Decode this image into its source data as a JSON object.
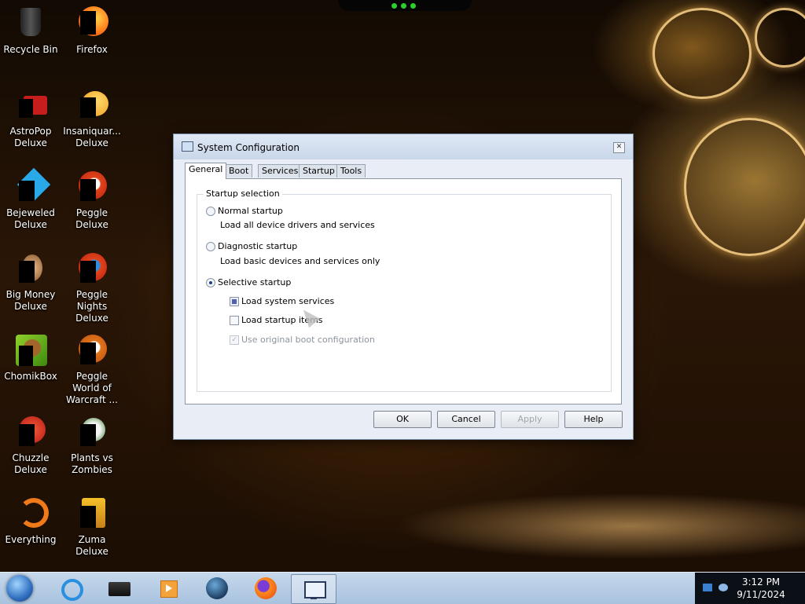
{
  "desktop": {
    "icons": [
      {
        "label": "Recycle Bin",
        "icon": "recycle-bin-icon"
      },
      {
        "label": "Firefox",
        "icon": "firefox-icon"
      },
      {
        "label": "AstroPop Deluxe",
        "icon": "astropop-icon"
      },
      {
        "label": "Insaniquar... Deluxe",
        "icon": "insaniquarium-icon"
      },
      {
        "label": "Bejeweled Deluxe",
        "icon": "bejeweled-icon"
      },
      {
        "label": "Peggle Deluxe",
        "icon": "peggle-icon"
      },
      {
        "label": "Big Money Deluxe",
        "icon": "big-money-icon"
      },
      {
        "label": "Peggle Nights Deluxe",
        "icon": "peggle-nights-icon"
      },
      {
        "label": "ChomikBox",
        "icon": "chomikbox-icon"
      },
      {
        "label": "Peggle World of Warcraft ...",
        "icon": "peggle-wow-icon"
      },
      {
        "label": "Chuzzle Deluxe",
        "icon": "chuzzle-icon"
      },
      {
        "label": "Plants vs Zombies",
        "icon": "plants-vs-zombies-icon"
      },
      {
        "label": "Everything",
        "icon": "everything-search-icon"
      },
      {
        "label": "Zuma Deluxe",
        "icon": "zuma-icon"
      }
    ]
  },
  "dialog": {
    "title": "System Configuration",
    "close_glyph": "✕",
    "tabs": [
      "General",
      "Boot",
      "Services",
      "Startup",
      "Tools"
    ],
    "active_tab": "General",
    "group_label": "Startup selection",
    "options": {
      "normal": {
        "label": "Normal startup",
        "desc": "Load all device drivers and services"
      },
      "diagnostic": {
        "label": "Diagnostic startup",
        "desc": "Load basic devices and services only"
      },
      "selective": {
        "label": "Selective startup"
      }
    },
    "selected_option": "selective",
    "checks": {
      "system_services": {
        "label": "Load system services",
        "state": "partial"
      },
      "startup_items": {
        "label": "Load startup items",
        "state": "unchecked"
      },
      "boot_config": {
        "label": "Use original boot configuration",
        "state": "checked-disabled"
      }
    },
    "check_glyph": "✓",
    "buttons": {
      "ok": "OK",
      "cancel": "Cancel",
      "apply": "Apply",
      "help": "Help"
    }
  },
  "taskbar": {
    "items": [
      "internet-explorer-icon",
      "drive-icon",
      "media-player-icon",
      "globe-icon",
      "firefox-icon",
      "system-configuration-icon"
    ],
    "active_item": "system-configuration-icon",
    "tray": {
      "time": "3:12 PM",
      "date": "9/11/2024"
    }
  },
  "colors": {
    "accent": "#1a3e8c",
    "taskbar": "#b4cbe5"
  }
}
